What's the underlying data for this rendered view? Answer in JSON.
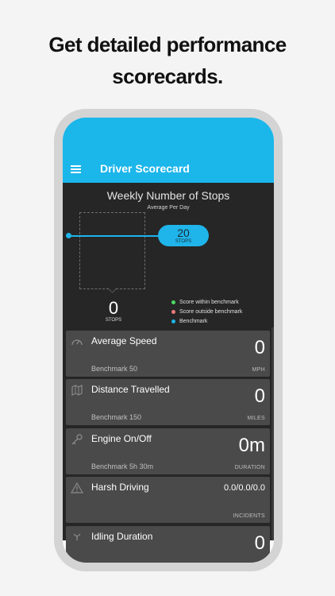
{
  "headline": [
    "Get detailed performance",
    "scorecards."
  ],
  "appbar": {
    "title": "Driver Scorecard",
    "menu_icon": "hamburger-menu-icon"
  },
  "chart": {
    "title": "Weekly Number of Stops",
    "subtitle": "Average Per Day",
    "benchmark_value": "20",
    "benchmark_unit": "STOPS",
    "current_value": "0",
    "current_unit": "STOPS",
    "legend": [
      {
        "label": "Score within benchmark",
        "color": "#4cd964"
      },
      {
        "label": "Score outside benchmark",
        "color": "#f27a7a"
      },
      {
        "label": "Benchmark",
        "color": "#1fb4ea"
      }
    ]
  },
  "cards": [
    {
      "title": "Average Speed",
      "value": "0",
      "benchmark": "Benchmark 50",
      "unit": "MPH",
      "icon": "speedometer-icon"
    },
    {
      "title": "Distance Travelled",
      "value": "0",
      "benchmark": "Benchmark 150",
      "unit": "MILES",
      "icon": "map-icon"
    },
    {
      "title": "Engine On/Off",
      "value": "0m",
      "benchmark": "Benchmark 5h 30m",
      "unit": "DURATION",
      "icon": "key-icon"
    },
    {
      "title": "Harsh Driving",
      "value": "0.0/0.0/0.0",
      "benchmark": "",
      "unit": "INCIDENTS",
      "icon": "warning-icon"
    },
    {
      "title": "Idling Duration",
      "value": "0",
      "benchmark": "",
      "unit": "",
      "icon": "idle-icon"
    }
  ],
  "colors": {
    "accent": "#1bb6ea",
    "dark_bg": "#262626",
    "card_bg": "#4a4a4a"
  }
}
